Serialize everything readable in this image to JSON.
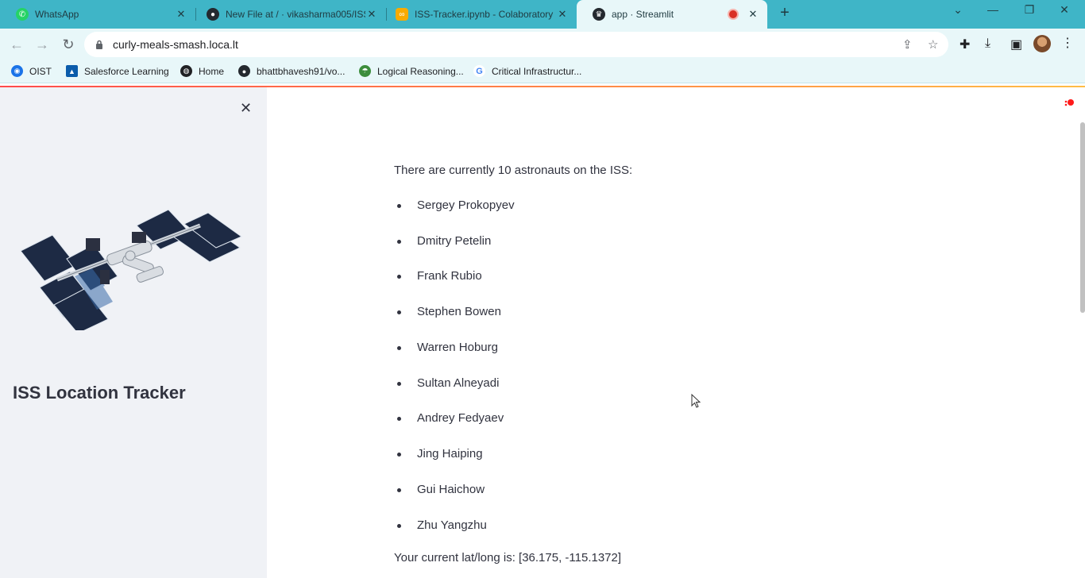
{
  "browser": {
    "tabs": [
      {
        "title": "WhatsApp",
        "icon": "whatsapp-icon",
        "color": "#25d366"
      },
      {
        "title": "New File at / · vikasharma005/ISS",
        "icon": "github-icon",
        "color": "#24292f"
      },
      {
        "title": "ISS-Tracker.ipynb - Colaboratory",
        "icon": "colab-icon",
        "color": "#f9ab00"
      },
      {
        "title": "app · Streamlit",
        "icon": "streamlit-icon",
        "color": "#24292f"
      }
    ],
    "address": "curly-meals-smash.loca.lt",
    "bookmarks": [
      {
        "label": "OIST",
        "icon": "oist-icon",
        "color": "#1a73e8"
      },
      {
        "label": "Salesforce Learning",
        "icon": "trailhead-icon",
        "color": "#0b5cab"
      },
      {
        "label": "Home",
        "icon": "globe-icon",
        "color": "#202124"
      },
      {
        "label": "bhattbhavesh91/vo...",
        "icon": "github-icon",
        "color": "#24292f"
      },
      {
        "label": "Logical Reasoning...",
        "icon": "leaf-icon",
        "color": "#3c8d3c"
      },
      {
        "label": "Critical Infrastructur...",
        "icon": "google-icon",
        "color": "#4285f4"
      }
    ]
  },
  "sidebar": {
    "title": "ISS Location Tracker",
    "image_subject": "iss-image"
  },
  "main": {
    "intro": "There are currently 10 astronauts on the ISS:",
    "astronauts": [
      "Sergey Prokopyev",
      "Dmitry Petelin",
      "Frank Rubio",
      "Stephen Bowen",
      "Warren Hoburg",
      "Sultan Alneyadi",
      "Andrey Fedyaev",
      "Jing Haiping",
      "Gui Haichow",
      "Zhu Yangzhu"
    ],
    "latlong": "Your current lat/long is: [36.175, -115.1372]"
  },
  "colors": {
    "accent": "#ff4b4b",
    "sidebar_bg": "#f0f2f6",
    "text": "#31333f",
    "chrome": "#3fb5c7"
  }
}
